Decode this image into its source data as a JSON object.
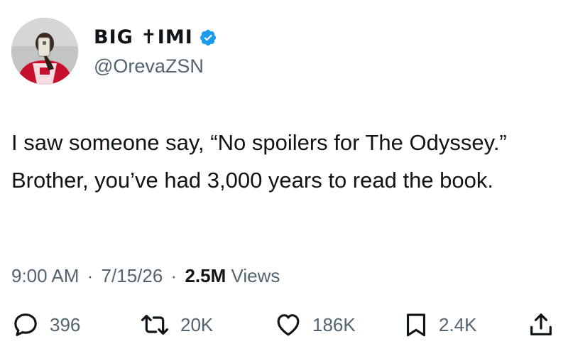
{
  "author": {
    "display_name": "BIG ✝IMI",
    "handle": "@OrevaZSN",
    "verified": true
  },
  "tweet": {
    "text": "I saw someone say, “No spoilers for The Odyssey.” Brother, you’ve had 3,000 years to read the book."
  },
  "meta": {
    "time": "9:00 AM",
    "separator": "·",
    "date": "7/15/26",
    "views_count": "2.5M",
    "views_label": "Views"
  },
  "actions": {
    "replies": "396",
    "reposts": "20K",
    "likes": "186K",
    "bookmarks": "2.4K"
  },
  "colors": {
    "text_primary": "#0f1419",
    "text_secondary": "#536471",
    "verified_blue": "#1d9bf0"
  },
  "icons": [
    "verified-badge-icon",
    "reply-icon",
    "repost-icon",
    "like-icon",
    "bookmark-icon",
    "share-icon"
  ]
}
